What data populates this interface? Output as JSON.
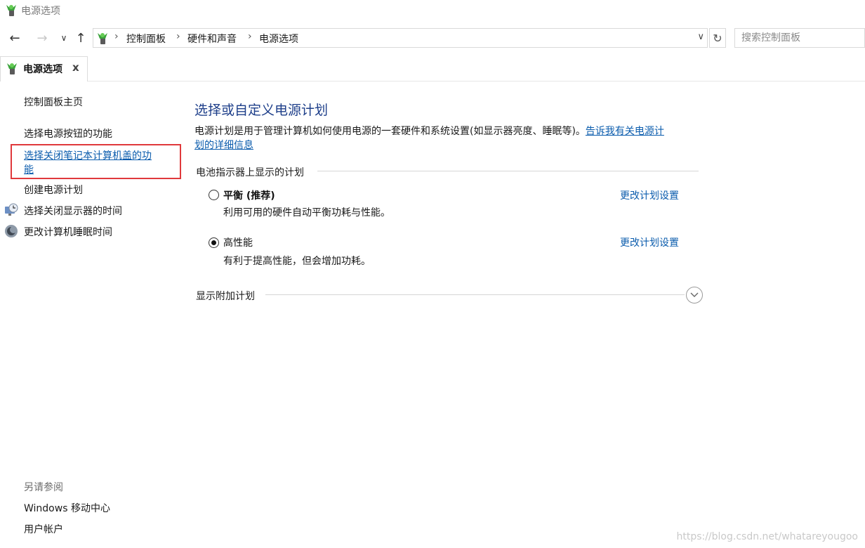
{
  "window": {
    "title": "电源选项"
  },
  "nav": {
    "back_icon": "arrow-left-icon",
    "forward_icon": "arrow-right-icon",
    "recent_icon": "chevron-down-icon",
    "up_icon": "arrow-up-icon",
    "refresh_icon": "refresh-icon"
  },
  "breadcrumb": [
    "控制面板",
    "硬件和声音",
    "电源选项"
  ],
  "search": {
    "placeholder": "搜索控制面板"
  },
  "tab": {
    "label": "电源选项",
    "close": "x"
  },
  "left_pane": {
    "home": "控制面板主页",
    "links": [
      {
        "label": "选择电源按钮的功能"
      },
      {
        "label_line1": "选择关闭笔记本计算机盖的功",
        "label_line2": "能"
      },
      {
        "label": "创建电源计划"
      },
      {
        "label": "选择关闭显示器的时间",
        "icon": "monitor-clock-icon"
      },
      {
        "label": "更改计算机睡眠时间",
        "icon": "moon-sleep-icon"
      }
    ],
    "see_also": {
      "heading": "另请参阅",
      "items": [
        "Windows 移动中心",
        "用户帐户"
      ]
    }
  },
  "main": {
    "heading": "选择或自定义电源计划",
    "description": "电源计划是用于管理计算机如何使用电源的一套硬件和系统设置(如显示器亮度、睡眠等)。",
    "description_link_line1": "告诉我有关电源计",
    "description_link_line2": "划的详细信息",
    "battery_section": "电池指示器上显示的计划",
    "plans": [
      {
        "name": "平衡 (推荐)",
        "description": "利用可用的硬件自动平衡功耗与性能。",
        "selected": false,
        "link": "更改计划设置"
      },
      {
        "name": "高性能",
        "description": "有利于提高性能，但会增加功耗。",
        "selected": true,
        "link": "更改计划设置"
      }
    ],
    "additional_plans": "显示附加计划"
  },
  "watermark": "https://blog.csdn.net/whatareyougoo",
  "colors": {
    "link": "#0b5cad",
    "heading": "#1e3f8a",
    "highlight_box": "#e0393c"
  }
}
